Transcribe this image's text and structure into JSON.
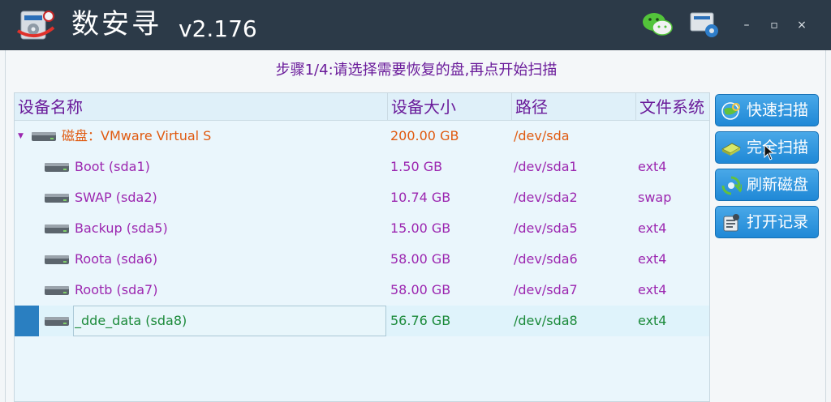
{
  "app": {
    "title": "数安寻",
    "version": "v2.176"
  },
  "window_controls": {
    "minimize": "–",
    "maximize": "▫",
    "close": "×"
  },
  "step_title": "步骤1/4:请选择需要恢复的盘,再点开始扫描",
  "table": {
    "headers": {
      "name": "设备名称",
      "size": "设备大小",
      "path": "路径",
      "fs": "文件系统"
    },
    "disk": {
      "name": "磁盘：VMware Virtual S",
      "size": "200.00 GB",
      "path": "/dev/sda",
      "fs": ""
    },
    "partitions": [
      {
        "name": "Boot (sda1)",
        "size": "1.50 GB",
        "path": "/dev/sda1",
        "fs": "ext4"
      },
      {
        "name": "SWAP (sda2)",
        "size": "10.74 GB",
        "path": "/dev/sda2",
        "fs": "swap"
      },
      {
        "name": "Backup (sda5)",
        "size": "15.00 GB",
        "path": "/dev/sda5",
        "fs": "ext4"
      },
      {
        "name": "Roota (sda6)",
        "size": "58.00 GB",
        "path": "/dev/sda6",
        "fs": "ext4"
      },
      {
        "name": "Rootb (sda7)",
        "size": "58.00 GB",
        "path": "/dev/sda7",
        "fs": "ext4"
      },
      {
        "name": "_dde_data (sda8)",
        "size": "56.76 GB",
        "path": "/dev/sda8",
        "fs": "ext4"
      }
    ],
    "selected_partition": "_dde_data (sda8)"
  },
  "buttons": {
    "quick_scan": "快速扫描",
    "full_scan": "完全扫描",
    "refresh_disk": "刷新磁盘",
    "open_log": "打开记录"
  },
  "colors": {
    "titlebar": "#2c3a48",
    "accent_purple": "#6a1b9a",
    "disk_orange": "#e05a10",
    "partition_purple": "#9c27b0",
    "selected_green": "#1b8a3a",
    "button_blue": "#1f88d6"
  }
}
